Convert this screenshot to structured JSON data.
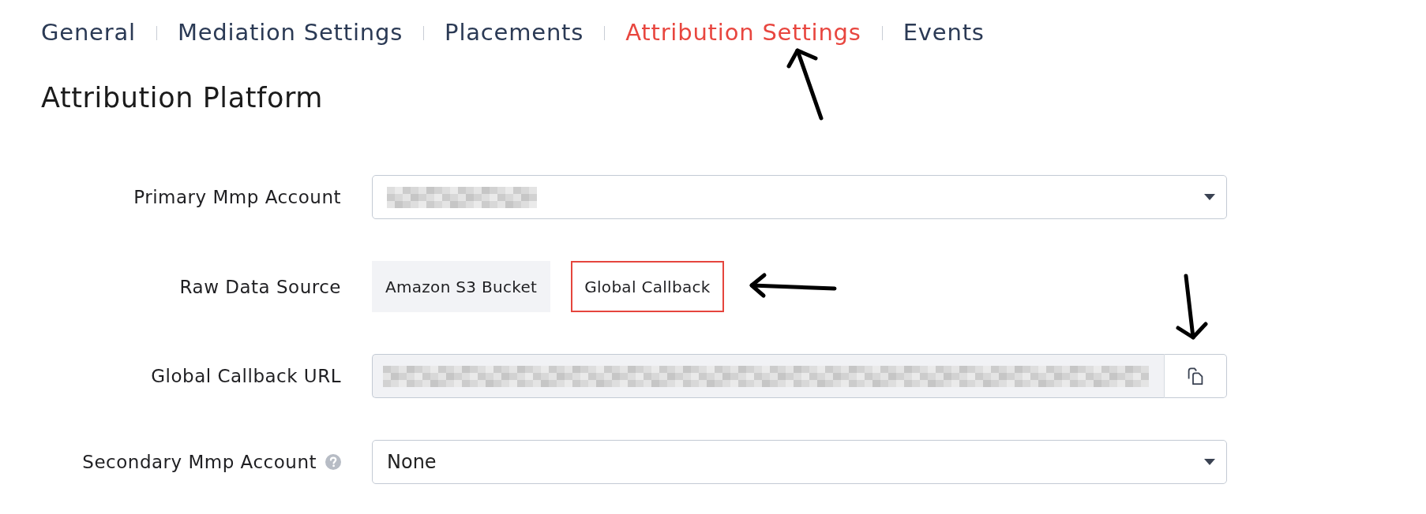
{
  "tabs": [
    {
      "label": "General",
      "selected": false
    },
    {
      "label": "Mediation Settings",
      "selected": false
    },
    {
      "label": "Placements",
      "selected": false
    },
    {
      "label": "Attribution Settings",
      "selected": true
    },
    {
      "label": "Events",
      "selected": false
    }
  ],
  "section": {
    "title": "Attribution Platform"
  },
  "form": {
    "rows": [
      {
        "kind": "select",
        "label": "Primary Mmp Account",
        "help": false,
        "redacted": true
      },
      {
        "kind": "toggle_group",
        "label": "Raw Data Source",
        "help": false,
        "options": [
          {
            "label": "Amazon S3 Bucket",
            "selected": false
          },
          {
            "label": "Global Callback",
            "selected": true
          }
        ]
      },
      {
        "kind": "copy_field",
        "label": "Global Callback URL",
        "help": false,
        "redacted": true,
        "disabled": true
      },
      {
        "kind": "select",
        "label": "Secondary Mmp Account",
        "help": true,
        "redacted": false,
        "value": "None"
      }
    ]
  }
}
